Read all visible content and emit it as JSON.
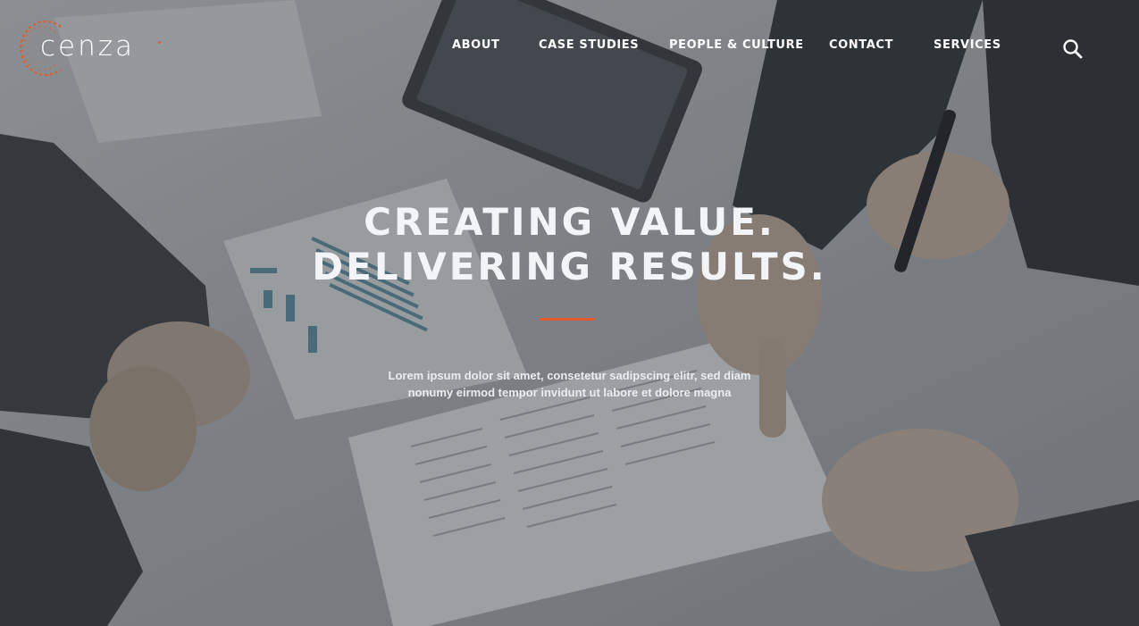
{
  "brand": {
    "name": "cenza",
    "accent_color": "#e05a2c",
    "mark_icon": "dashed-ring-logo-icon"
  },
  "nav": {
    "items": [
      {
        "label": "ABOUT"
      },
      {
        "label": "CASE STUDIES"
      },
      {
        "label": "PEOPLE & CULTURE"
      },
      {
        "label": "CONTACT"
      },
      {
        "label": "SERVICES"
      }
    ],
    "search_icon": "search-icon"
  },
  "hero": {
    "title_lines": [
      "CREATING VALUE.",
      "DELIVERING RESULTS."
    ],
    "text_lines": [
      "Lorem ipsum dolor sit amet, consetetur sadipscing elitr, sed diam",
      "nonumy eirmod tempor invidunt ut labore et dolore magna"
    ],
    "background_description_icon": "business-meeting-photo"
  },
  "colors": {
    "text": "#ffffff",
    "overlay": "#282c32",
    "divider": "#e05a2c"
  }
}
